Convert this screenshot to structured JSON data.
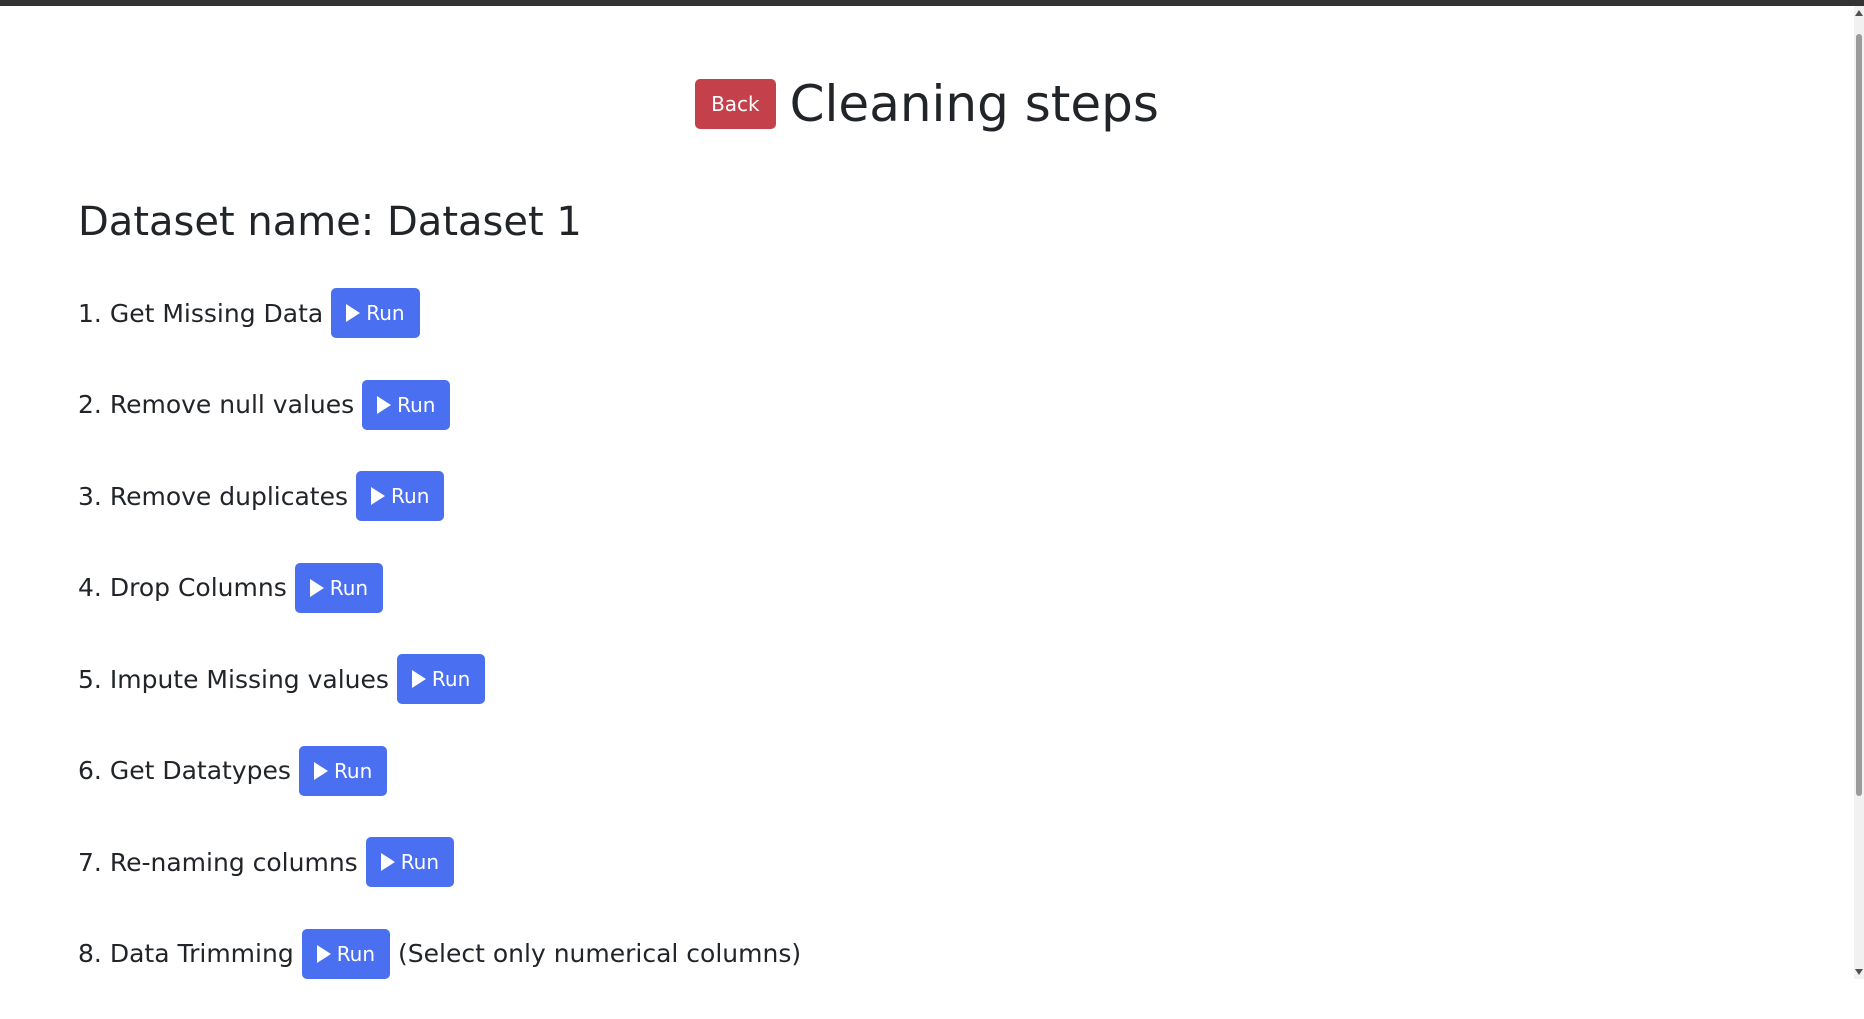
{
  "header": {
    "back_label": "Back",
    "title": "Cleaning steps"
  },
  "dataset": {
    "label": "Dataset name:",
    "name": "Dataset 1"
  },
  "steps": [
    {
      "number": "1.",
      "label": "Get Missing Data",
      "button": "Run",
      "note": ""
    },
    {
      "number": "2.",
      "label": "Remove null values",
      "button": "Run",
      "note": ""
    },
    {
      "number": "3.",
      "label": "Remove duplicates",
      "button": "Run",
      "note": ""
    },
    {
      "number": "4.",
      "label": "Drop Columns",
      "button": "Run",
      "note": ""
    },
    {
      "number": "5.",
      "label": "Impute Missing values",
      "button": "Run",
      "note": ""
    },
    {
      "number": "6.",
      "label": "Get Datatypes",
      "button": "Run",
      "note": ""
    },
    {
      "number": "7.",
      "label": "Re-naming columns",
      "button": "Run",
      "note": ""
    },
    {
      "number": "8.",
      "label": "Data Trimming",
      "button": "Run",
      "note": "(Select only numerical columns)"
    }
  ],
  "icons": {
    "run": "play-icon"
  },
  "colors": {
    "back_button": "#c4414b",
    "run_button": "#4a6ff0",
    "text": "#212529"
  }
}
